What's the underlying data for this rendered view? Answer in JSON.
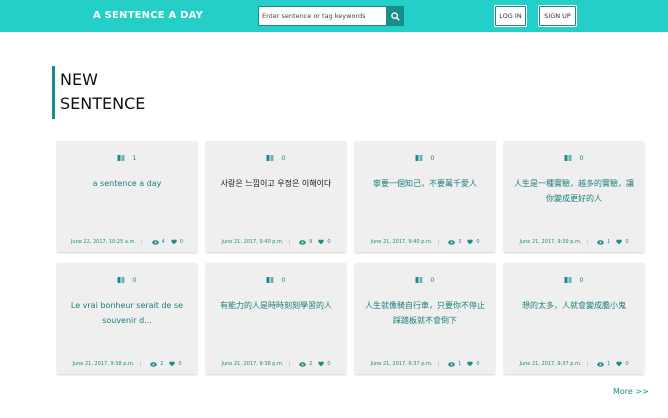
{
  "header": {
    "brand": "A SENTENCE A DAY",
    "search_placeholder": "Enter sentence or tag keywords",
    "login_label": "LOG IN",
    "signup_label": "SIGN UP"
  },
  "page_title": [
    "NEW",
    "SENTENCE"
  ],
  "cards": [
    {
      "views": "1",
      "text": "a sentence a day",
      "date": "June 22, 2017, 10:25 a.m.",
      "comments": "4",
      "likes": "0"
    },
    {
      "views": "0",
      "text": "사랑은 느낌이고 우정은 이해이다",
      "date": "June 21, 2017, 9:40 p.m.",
      "comments": "9",
      "likes": "0"
    },
    {
      "views": "0",
      "text": "寧要一個知己，不要萬千愛人",
      "date": "June 21, 2017, 9:40 p.m.",
      "comments": "3",
      "likes": "0"
    },
    {
      "views": "0",
      "text": "人生是一種實驗，越多的實驗，讓你變成更好的人",
      "date": "June 21, 2017, 9:39 p.m.",
      "comments": "1",
      "likes": "0"
    },
    {
      "views": "0",
      "text": "Le vrai bonheur serait de se souvenir d...",
      "date": "June 21, 2017, 9:38 p.m.",
      "comments": "2",
      "likes": "0"
    },
    {
      "views": "0",
      "text": "有能力的人是時時刻刻學習的人",
      "date": "June 21, 2017, 9:38 p.m.",
      "comments": "2",
      "likes": "0"
    },
    {
      "views": "0",
      "text": "人生就像騎自行車，只要你不停止踩踏板就不會倒下",
      "date": "June 21, 2017, 9:37 p.m.",
      "comments": "1",
      "likes": "0"
    },
    {
      "views": "0",
      "text": "想的太多，人就會變成膽小鬼",
      "date": "June 21, 2017, 9:37 p.m.",
      "comments": "1",
      "likes": "0"
    }
  ],
  "more_label": "More >>",
  "icons": {
    "views": "book-icon",
    "comments": "eye-icon",
    "likes": "heart-icon",
    "search": "search-icon"
  },
  "colors": {
    "nav": "#24cfc7",
    "accent": "#1b8c87",
    "card": "#efefef"
  }
}
